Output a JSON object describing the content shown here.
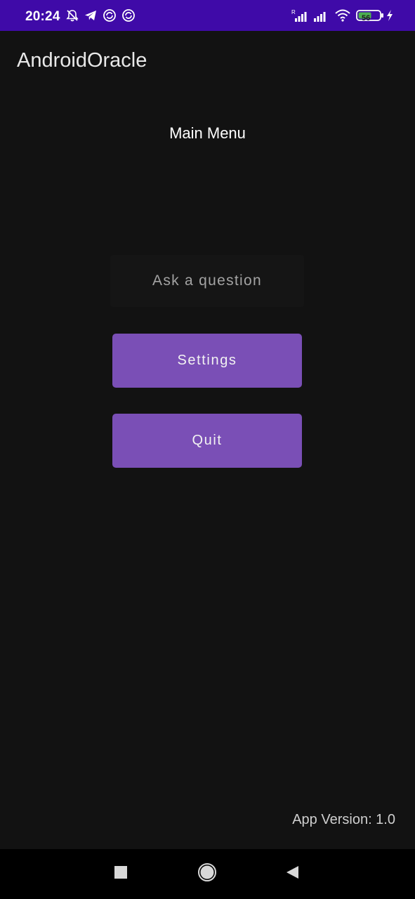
{
  "status_bar": {
    "time": "20:24",
    "battery_level": "56",
    "icons": [
      "bell-off-icon",
      "telegram-icon",
      "sync-icon",
      "sync-icon",
      "signal-r-icon",
      "signal-icon",
      "wifi-icon",
      "battery-icon",
      "charging-icon"
    ]
  },
  "app_bar": {
    "title": "AndroidOracle"
  },
  "main": {
    "title": "Main Menu",
    "ask_button_label": "Ask a question",
    "settings_button_label": "Settings",
    "quit_button_label": "Quit"
  },
  "footer": {
    "version_text": "App Version: 1.0"
  },
  "nav_bar": {
    "icons": [
      "recents-square-icon",
      "home-circle-icon",
      "back-triangle-icon"
    ]
  },
  "colors": {
    "status_bar": "#3f0aa8",
    "background": "#121212",
    "button": "#7a4fb6",
    "nav_bar": "#000000"
  }
}
